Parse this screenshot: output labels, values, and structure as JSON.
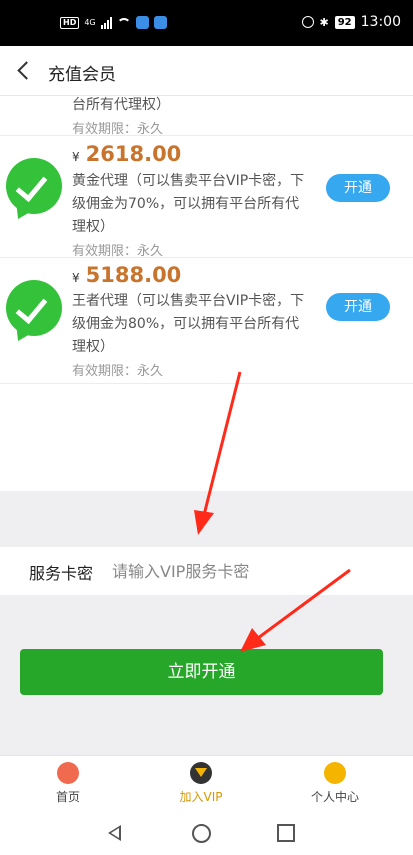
{
  "status_bar": {
    "time": "13:00",
    "battery": "92",
    "network": "4G",
    "hd": "HD"
  },
  "header": {
    "title": "充值会员"
  },
  "list": {
    "partial_item": {
      "desc_tail": "台所有代理权）",
      "validity": "有效期限：永久"
    },
    "items": [
      {
        "currency": "¥",
        "price": "2618.00",
        "desc": "黄金代理（可以售卖平台VIP卡密，下级佣金为70%，可以拥有平台所有代理权）",
        "validity": "有效期限：永久",
        "button": "开通"
      },
      {
        "currency": "¥",
        "price": "5188.00",
        "desc": "王者代理（可以售卖平台VIP卡密，下级佣金为80%，可以拥有平台所有代理权）",
        "validity": "有效期限：永久",
        "button": "开通"
      }
    ]
  },
  "card": {
    "label": "服务卡密",
    "placeholder": "请输入VIP服务卡密"
  },
  "submit": {
    "label": "立即开通"
  },
  "tabbar": {
    "items": [
      {
        "label": "首页",
        "icon": "home-icon"
      },
      {
        "label": "加入VIP",
        "icon": "vip-icon",
        "active": true
      },
      {
        "label": "个人中心",
        "icon": "user-icon"
      }
    ]
  },
  "colors": {
    "price": "#c8742c",
    "open_button": "#35a8f0",
    "submit_button": "#27a72a",
    "active_tab": "#d69a00",
    "annotation_arrow": "#ff2a1a"
  }
}
